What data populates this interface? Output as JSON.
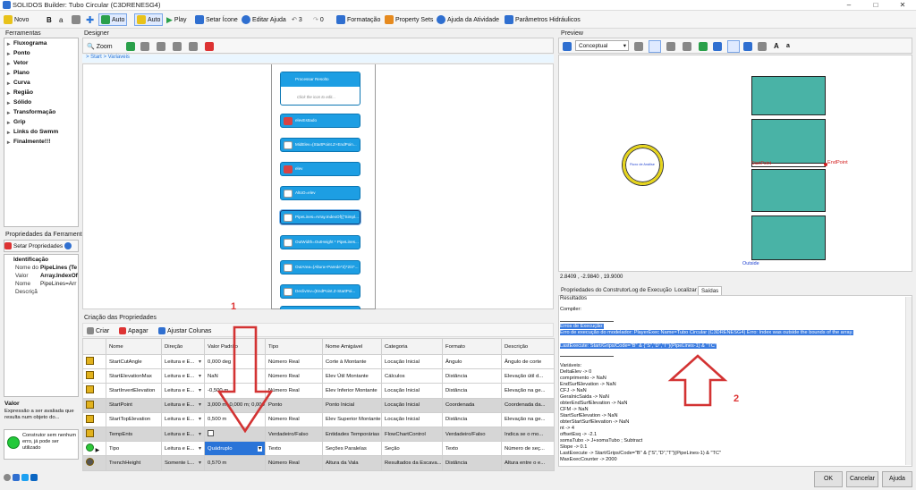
{
  "window": {
    "title": "SOLIDOS Builder: Tubo Circular (C3DRENESG4)"
  },
  "toolbar": {
    "novo": "Novo",
    "b_label": "B",
    "a_label": "a",
    "auto1": "Auto",
    "auto2": "Auto",
    "play": "Play",
    "setar_icone": "Setar Ícone",
    "editar_ajuda": "Editar Ajuda",
    "undo_count": "3",
    "redo_count": "0",
    "formatacao": "Formatação",
    "property_sets": "Property Sets",
    "ajuda_atividade": "Ajuda da Atividade",
    "parametros": "Parâmetros Hidráulicos"
  },
  "ferramentas": {
    "title": "Ferramentas",
    "items": [
      "Fluxograma",
      "Ponto",
      "Vetor",
      "Plano",
      "Curva",
      "Região",
      "Sólido",
      "Transformação",
      "Grip",
      "Links do Swmm",
      "Finalmente!!!"
    ]
  },
  "propriedades_ferramenta": {
    "title": "Propriedades da Ferramenta",
    "setar_button": "Setar Propriedades",
    "section": "Identificação",
    "rows": [
      {
        "key": "Nome do",
        "value": "PipeLines (Te"
      },
      {
        "key": "Valor",
        "value": "Array.IndexOf("
      },
      {
        "key": "Nome",
        "value": "PipeLines=Arr"
      },
      {
        "key": "Descriçã",
        "value": ""
      }
    ]
  },
  "valor_help": {
    "title": "Valor",
    "text": "Expressão a ser avaliada que resulta num objeto do..."
  },
  "status": {
    "text": "Construtor sem nenhum erro, já pode ser utilizado"
  },
  "designer": {
    "title": "Designer",
    "zoom": "Zoom",
    "breadcrumb": "> Start > Variaveis",
    "process_title": "Processar Resolto",
    "process_hint": "Click the icon to edit...",
    "nodes": [
      "elevEsttado",
      "MidElev=(StartPoint.Z+EndPoin...",
      "elev",
      "AltoO=elev",
      "PipeLines=Array.IndexOf({\"Simpl...",
      "OutWidth=OutHeight * PipeLines...",
      "OutArea=(Altura+Parede*2)*2/4*...",
      "DeclivInv=(EndPoint.Z-StartPoi..."
    ]
  },
  "criacao": {
    "title": "Criação das Propriedades",
    "criar": "Criar",
    "apagar": "Apagar",
    "ajustar": "Ajustar Colunas",
    "headers": [
      "",
      "Nome",
      "Direção",
      "Valor Padrão",
      "Tipo",
      "Nome Amigável",
      "Categoria",
      "Formato",
      "Descrição"
    ],
    "rows": [
      [
        "StartCutAngle",
        "Leitura e E...",
        "0,000 deg",
        "Número Real",
        "Corte à Montante",
        "Locação Inicial",
        "Ângulo",
        "Ângulo de corte"
      ],
      [
        "StartElevationMax",
        "Leitura e E...",
        "NaN",
        "Número Real",
        "Elev Útil Montante",
        "Cálculos",
        "Distância",
        "Elevação útil d..."
      ],
      [
        "StartInvertElevation",
        "Leitura e E...",
        "-0,500 m",
        "Número Real",
        "Elev Inferior Montante",
        "Locação Inicial",
        "Distância",
        "Elevação na ge..."
      ],
      [
        "StartPoint",
        "Leitura e E...",
        "3,000 m; 0,000 m; 0,000",
        "Ponto",
        "Ponto Inicial",
        "Locação Inicial",
        "Coordenada",
        "Coordenada da..."
      ],
      [
        "StartTopElevation",
        "Leitura e E...",
        "0,500 m",
        "Número Real",
        "Elev Superior Montante",
        "Locação Inicial",
        "Distância",
        "Elevação na ge..."
      ],
      [
        "TempEnts",
        "Leitura e E...",
        "",
        "Verdadeiro/Falso",
        "Entidades Temporárias",
        "FlowChartControl",
        "Verdadeiro/Falso",
        "Indica se o mo..."
      ],
      [
        "Tipo",
        "Leitura e E...",
        "Quádruplo",
        "Texto",
        "Seções Paralelas",
        "Seção",
        "Texto",
        "Número de seç..."
      ],
      [
        "TrenchHeight",
        "Somente L...",
        "0,570 m",
        "Número Real",
        "Altura da Vala",
        "Resultados da Escava...",
        "Distância",
        "Altura entre o e..."
      ]
    ]
  },
  "preview": {
    "title": "Preview",
    "view": "Conceptual",
    "a_big": "A",
    "a_small": "a",
    "coords": "2.8409 , -2.9840 , 19.9000",
    "end_point": "EndPoint",
    "start_point": "StartPoint",
    "outside": "Outside",
    "circle_label": "Fluxo de Análise"
  },
  "tabs": [
    "Propriedades do Construtor",
    "Log de Execução",
    "Localizar",
    "Saídas"
  ],
  "resultados": {
    "title": "Resultados",
    "compiler": "Compiler:",
    "error_lines": [
      "Erros de Execução:",
      "Erro de execução do modelador: PlayerExec Name=Tubo Circular (C3DRENESG4) Erro: Index was outside the bounds of the array.",
      "LastExecute: Start/Grips/Code=\"B\" & {\"S\",\"D\",\"T\"}(PipeLines-1) & \"TC\""
    ],
    "var_lines": [
      "Variáveis:",
      "DeltaElev -> 0",
      "comprimento -> NaN",
      "EndSurfElevation -> NaN",
      "CFJ -> NaN",
      "GeraInicSaida -> NaN",
      "obterEndSurfElevation -> NaN",
      "CFM -> NaN",
      "StartSurfElevation -> NaN",
      "obterStartSurfElevation -> NaN",
      "nt -> 4",
      "offsetEsq -> -2.1",
      "somaTubo -> J+somaTubo ; Subtract",
      "Slope -> 0.1",
      "LastExecute -> Start/Grips/Code=\"B\" & {\"S\",\"D\",\"T\"}(PipeLines-1) & \"TC\"",
      "MaxExecCounter -> 2000"
    ]
  },
  "annotations": {
    "one": "1",
    "two": "2"
  },
  "footer": {
    "ok": "OK",
    "cancelar": "Cancelar",
    "ajuda": "Ajuda"
  },
  "colors": {
    "accent": "#2a74d8",
    "arrow": "#d33333",
    "node": "#1d9ee3",
    "solid": "#49b3a6"
  }
}
